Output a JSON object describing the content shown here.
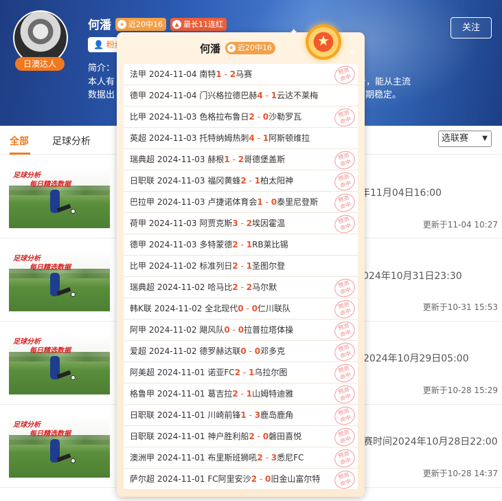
{
  "expert": {
    "name": "何潘",
    "badge": "日澳达人",
    "tag_record": "近20中16",
    "tag_streak": "最长11连红",
    "fans_label": "粉丝",
    "intro_label": "简介：",
    "intro_line1": "本人有",
    "intro_line1_tail": "析，能从主流",
    "intro_line2": "数据出",
    "intro_line2_tail": "期稳定。",
    "follow_label": "关注"
  },
  "tabs": [
    {
      "label": "全部"
    },
    {
      "label": "足球分析"
    }
  ],
  "league_select": {
    "value": "选联赛"
  },
  "articles": [
    {
      "thumb_line1": "足球分析",
      "thumb_line2": "每日精选数据",
      "match_time": "年11月04日16:00",
      "updated": "更新于11-04 10:27"
    },
    {
      "thumb_line1": "足球分析",
      "thumb_line2": "每日精选数据",
      "match_time": "024年10月31日23:30",
      "updated": "更新于10-31 15:53"
    },
    {
      "thumb_line1": "足球分析",
      "thumb_line2": "每日精选数据",
      "match_time": "2024年10月29日05:00",
      "updated": "更新于10-28 15:29"
    },
    {
      "thumb_line1": "足球分析",
      "thumb_line2": "每日精选数据",
      "match_time": "赛时间2024年10月28日22:00",
      "updated": "更新于10-28 14:37"
    }
  ],
  "popup": {
    "title": "何潘",
    "tag": "近20中16",
    "stamp_text_1": "预测",
    "stamp_text_2": "命中",
    "matches": [
      {
        "league": "法甲",
        "date": "2024-11-04",
        "home": "南特",
        "hs": "1",
        "as": "2",
        "away": "马赛",
        "hit": true
      },
      {
        "league": "德甲",
        "date": "2024-11-04",
        "home": "门兴格拉德巴赫",
        "hs": "4",
        "as": "1",
        "away": "云达不莱梅",
        "hit": false
      },
      {
        "league": "比甲",
        "date": "2024-11-03",
        "home": "色格拉布鲁日",
        "hs": "2",
        "as": "0",
        "away": "沙勒罗瓦",
        "hit": true
      },
      {
        "league": "英超",
        "date": "2024-11-03",
        "home": "托特纳姆热刺",
        "hs": "4",
        "as": "1",
        "away": "阿斯顿维拉",
        "hit": false
      },
      {
        "league": "瑞典超",
        "date": "2024-11-03",
        "home": "赫根",
        "hs": "1",
        "as": "2",
        "away": "哥德堡盖斯",
        "hit": true
      },
      {
        "league": "日职联",
        "date": "2024-11-03",
        "home": "福冈黄蜂",
        "hs": "2",
        "as": "1",
        "away": "柏太阳神",
        "hit": true
      },
      {
        "league": "巴拉甲",
        "date": "2024-11-03",
        "home": "卢捷诺体育会",
        "hs": "1",
        "as": "0",
        "away": "泰里尼登斯",
        "hit": true
      },
      {
        "league": "荷甲",
        "date": "2024-11-03",
        "home": "阿贾克斯",
        "hs": "3",
        "as": "2",
        "away": "埃因霍温",
        "hit": true
      },
      {
        "league": "德甲",
        "date": "2024-11-03",
        "home": "多特蒙德",
        "hs": "2",
        "as": "1",
        "away": "RB莱比锡",
        "hit": false
      },
      {
        "league": "比甲",
        "date": "2024-11-02",
        "home": "标准列日",
        "hs": "2",
        "as": "1",
        "away": "圣图尔登",
        "hit": false
      },
      {
        "league": "瑞典超",
        "date": "2024-11-02",
        "home": "哈马比",
        "hs": "2",
        "as": "2",
        "away": "马尔默",
        "hit": true
      },
      {
        "league": "韩K联",
        "date": "2024-11-02",
        "home": "全北现代",
        "hs": "0",
        "as": "0",
        "away": "仁川联队",
        "hit": true
      },
      {
        "league": "阿甲",
        "date": "2024-11-02",
        "home": "飓风队",
        "hs": "0",
        "as": "0",
        "away": "拉普拉塔体操",
        "hit": true
      },
      {
        "league": "爱超",
        "date": "2024-11-02",
        "home": "德罗赫达联",
        "hs": "0",
        "as": "0",
        "away": "邓多克",
        "hit": true
      },
      {
        "league": "阿美超",
        "date": "2024-11-01",
        "home": "诺亚FC",
        "hs": "2",
        "as": "1",
        "away": "乌拉尔图",
        "hit": true
      },
      {
        "league": "格鲁甲",
        "date": "2024-11-01",
        "home": "葛吉拉",
        "hs": "2",
        "as": "1",
        "away": "山姆特迪雅",
        "hit": true
      },
      {
        "league": "日职联",
        "date": "2024-11-01",
        "home": "川崎前锋",
        "hs": "1",
        "as": "3",
        "away": "鹿岛鹿角",
        "hit": true
      },
      {
        "league": "日职联",
        "date": "2024-11-01",
        "home": "神户胜利船",
        "hs": "2",
        "as": "0",
        "away": "磐田喜悦",
        "hit": true
      },
      {
        "league": "澳洲甲",
        "date": "2024-11-01",
        "home": "布里斯班狮吼",
        "hs": "2",
        "as": "3",
        "away": "悉尼FC",
        "hit": true
      },
      {
        "league": "萨尔超",
        "date": "2024-11-01",
        "home": "FC阿里安沙",
        "hs": "2",
        "as": "0",
        "away": "旧金山富尔特",
        "hit": true
      }
    ]
  },
  "colors": {
    "accent": "#f07a1f",
    "score": "#e8542b",
    "header_blue": "#2b5bb3"
  }
}
